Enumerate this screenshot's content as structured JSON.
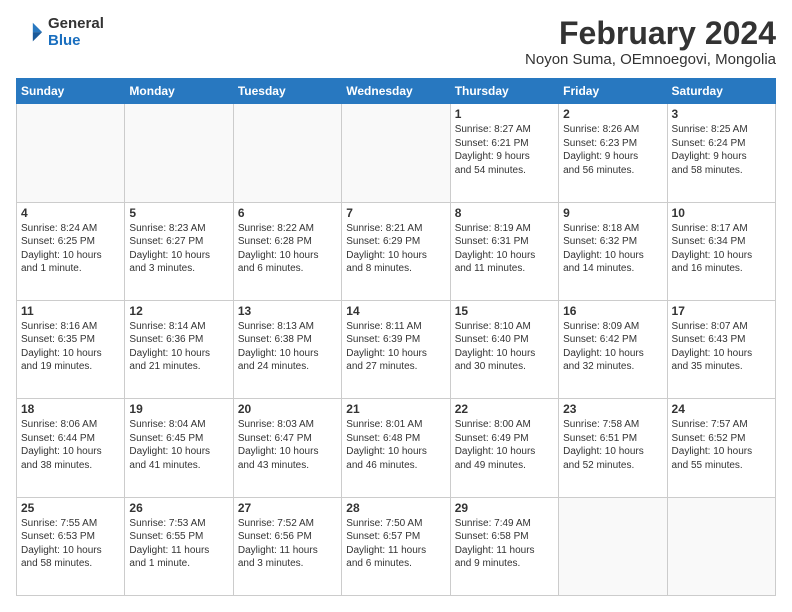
{
  "logo": {
    "general": "General",
    "blue": "Blue"
  },
  "title": "February 2024",
  "subtitle": "Noyon Suma, OEmnoegovi, Mongolia",
  "days_header": [
    "Sunday",
    "Monday",
    "Tuesday",
    "Wednesday",
    "Thursday",
    "Friday",
    "Saturday"
  ],
  "weeks": [
    [
      {
        "num": "",
        "info": ""
      },
      {
        "num": "",
        "info": ""
      },
      {
        "num": "",
        "info": ""
      },
      {
        "num": "",
        "info": ""
      },
      {
        "num": "1",
        "info": "Sunrise: 8:27 AM\nSunset: 6:21 PM\nDaylight: 9 hours\nand 54 minutes."
      },
      {
        "num": "2",
        "info": "Sunrise: 8:26 AM\nSunset: 6:23 PM\nDaylight: 9 hours\nand 56 minutes."
      },
      {
        "num": "3",
        "info": "Sunrise: 8:25 AM\nSunset: 6:24 PM\nDaylight: 9 hours\nand 58 minutes."
      }
    ],
    [
      {
        "num": "4",
        "info": "Sunrise: 8:24 AM\nSunset: 6:25 PM\nDaylight: 10 hours\nand 1 minute."
      },
      {
        "num": "5",
        "info": "Sunrise: 8:23 AM\nSunset: 6:27 PM\nDaylight: 10 hours\nand 3 minutes."
      },
      {
        "num": "6",
        "info": "Sunrise: 8:22 AM\nSunset: 6:28 PM\nDaylight: 10 hours\nand 6 minutes."
      },
      {
        "num": "7",
        "info": "Sunrise: 8:21 AM\nSunset: 6:29 PM\nDaylight: 10 hours\nand 8 minutes."
      },
      {
        "num": "8",
        "info": "Sunrise: 8:19 AM\nSunset: 6:31 PM\nDaylight: 10 hours\nand 11 minutes."
      },
      {
        "num": "9",
        "info": "Sunrise: 8:18 AM\nSunset: 6:32 PM\nDaylight: 10 hours\nand 14 minutes."
      },
      {
        "num": "10",
        "info": "Sunrise: 8:17 AM\nSunset: 6:34 PM\nDaylight: 10 hours\nand 16 minutes."
      }
    ],
    [
      {
        "num": "11",
        "info": "Sunrise: 8:16 AM\nSunset: 6:35 PM\nDaylight: 10 hours\nand 19 minutes."
      },
      {
        "num": "12",
        "info": "Sunrise: 8:14 AM\nSunset: 6:36 PM\nDaylight: 10 hours\nand 21 minutes."
      },
      {
        "num": "13",
        "info": "Sunrise: 8:13 AM\nSunset: 6:38 PM\nDaylight: 10 hours\nand 24 minutes."
      },
      {
        "num": "14",
        "info": "Sunrise: 8:11 AM\nSunset: 6:39 PM\nDaylight: 10 hours\nand 27 minutes."
      },
      {
        "num": "15",
        "info": "Sunrise: 8:10 AM\nSunset: 6:40 PM\nDaylight: 10 hours\nand 30 minutes."
      },
      {
        "num": "16",
        "info": "Sunrise: 8:09 AM\nSunset: 6:42 PM\nDaylight: 10 hours\nand 32 minutes."
      },
      {
        "num": "17",
        "info": "Sunrise: 8:07 AM\nSunset: 6:43 PM\nDaylight: 10 hours\nand 35 minutes."
      }
    ],
    [
      {
        "num": "18",
        "info": "Sunrise: 8:06 AM\nSunset: 6:44 PM\nDaylight: 10 hours\nand 38 minutes."
      },
      {
        "num": "19",
        "info": "Sunrise: 8:04 AM\nSunset: 6:45 PM\nDaylight: 10 hours\nand 41 minutes."
      },
      {
        "num": "20",
        "info": "Sunrise: 8:03 AM\nSunset: 6:47 PM\nDaylight: 10 hours\nand 43 minutes."
      },
      {
        "num": "21",
        "info": "Sunrise: 8:01 AM\nSunset: 6:48 PM\nDaylight: 10 hours\nand 46 minutes."
      },
      {
        "num": "22",
        "info": "Sunrise: 8:00 AM\nSunset: 6:49 PM\nDaylight: 10 hours\nand 49 minutes."
      },
      {
        "num": "23",
        "info": "Sunrise: 7:58 AM\nSunset: 6:51 PM\nDaylight: 10 hours\nand 52 minutes."
      },
      {
        "num": "24",
        "info": "Sunrise: 7:57 AM\nSunset: 6:52 PM\nDaylight: 10 hours\nand 55 minutes."
      }
    ],
    [
      {
        "num": "25",
        "info": "Sunrise: 7:55 AM\nSunset: 6:53 PM\nDaylight: 10 hours\nand 58 minutes."
      },
      {
        "num": "26",
        "info": "Sunrise: 7:53 AM\nSunset: 6:55 PM\nDaylight: 11 hours\nand 1 minute."
      },
      {
        "num": "27",
        "info": "Sunrise: 7:52 AM\nSunset: 6:56 PM\nDaylight: 11 hours\nand 3 minutes."
      },
      {
        "num": "28",
        "info": "Sunrise: 7:50 AM\nSunset: 6:57 PM\nDaylight: 11 hours\nand 6 minutes."
      },
      {
        "num": "29",
        "info": "Sunrise: 7:49 AM\nSunset: 6:58 PM\nDaylight: 11 hours\nand 9 minutes."
      },
      {
        "num": "",
        "info": ""
      },
      {
        "num": "",
        "info": ""
      }
    ]
  ]
}
